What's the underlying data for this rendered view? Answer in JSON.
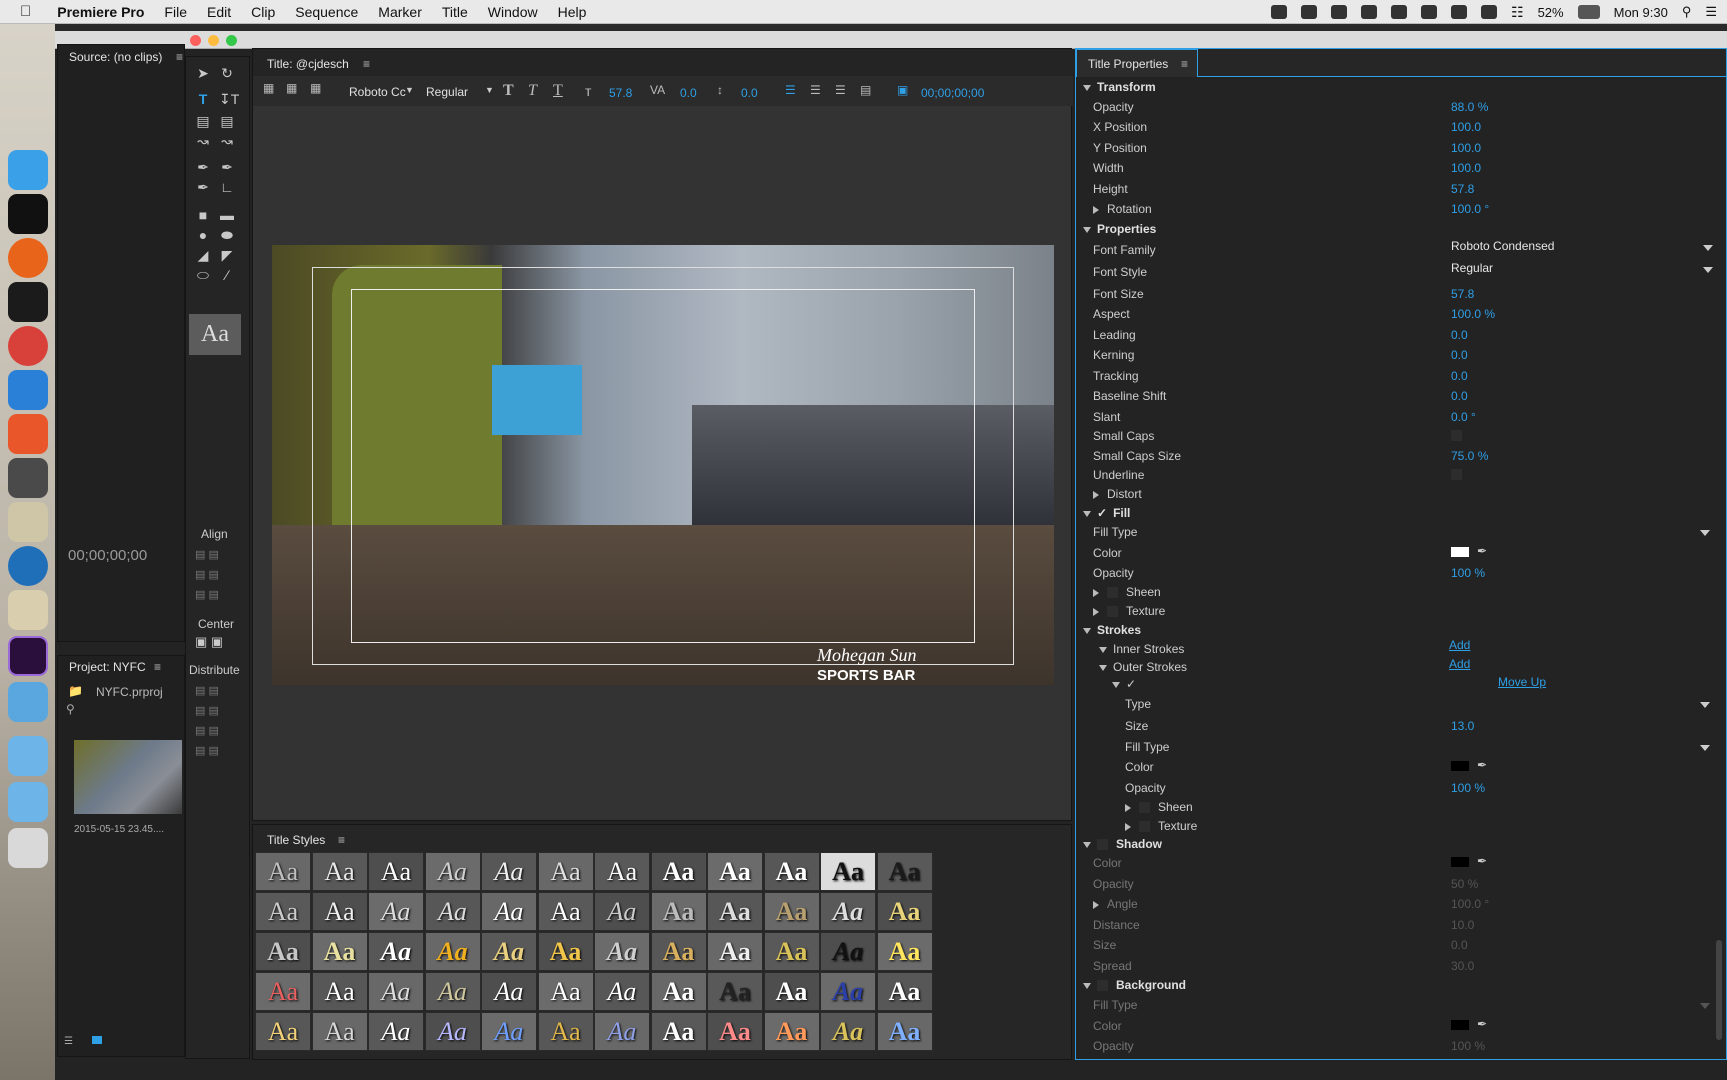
{
  "menubar": {
    "app": "Premiere Pro",
    "items": [
      "File",
      "Edit",
      "Clip",
      "Sequence",
      "Marker",
      "Title",
      "Window",
      "Help"
    ],
    "battery": "52%",
    "clock": "Mon 9:30"
  },
  "source_panel": {
    "title": "Source: (no clips)",
    "timecode": "00;00;00;00"
  },
  "project_panel": {
    "title": "Project: NYFC",
    "file": "NYFC.prproj",
    "clip_label": "2015-05-15 23.45...."
  },
  "title_panel": {
    "title": "Title: @cjdesch",
    "font": "Roboto Cc",
    "style": "Regular",
    "size": "57.8",
    "kerning": "0.0",
    "leading": "0.0",
    "timecode": "00;00;00;00"
  },
  "video": {
    "watermark": "Mohegan Sun",
    "sub": "SPORTS BAR"
  },
  "tools": {
    "sample": "Aa",
    "align": "Align",
    "center": "Center",
    "distribute": "Distribute"
  },
  "title_styles": {
    "title": "Title Styles",
    "sample": "Aa"
  },
  "props": {
    "title": "Title Properties",
    "transform": "Transform",
    "opacity_l": "Opacity",
    "opacity_v": "88.0 %",
    "xpos_l": "X Position",
    "xpos_v": "100.0",
    "ypos_l": "Y Position",
    "ypos_v": "100.0",
    "width_l": "Width",
    "width_v": "100.0",
    "height_l": "Height",
    "height_v": "57.8",
    "rot_l": "Rotation",
    "rot_v": "100.0 °",
    "properties": "Properties",
    "ff_l": "Font Family",
    "ff_v": "Roboto Condensed",
    "fs_l": "Font Style",
    "fs_v": "Regular",
    "fsize_l": "Font Size",
    "fsize_v": "57.8",
    "aspect_l": "Aspect",
    "aspect_v": "100.0 %",
    "leading_l": "Leading",
    "leading_v": "0.0",
    "kerning_l": "Kerning",
    "kerning_v": "0.0",
    "tracking_l": "Tracking",
    "tracking_v": "0.0",
    "baseline_l": "Baseline Shift",
    "baseline_v": "0.0",
    "slant_l": "Slant",
    "slant_v": "0.0 °",
    "smallcaps_l": "Small Caps",
    "smallcapssize_l": "Small Caps Size",
    "smallcapssize_v": "75.0 %",
    "underline_l": "Underline",
    "distort_l": "Distort",
    "fill": "Fill",
    "filltype_l": "Fill Type",
    "color_l": "Color",
    "fillopacity_l": "Opacity",
    "fillopacity_v": "100 %",
    "sheen_l": "Sheen",
    "texture_l": "Texture",
    "strokes": "Strokes",
    "inner_l": "Inner Strokes",
    "inner_add": "Add",
    "outer_l": "Outer Strokes",
    "outer_add": "Add",
    "moveup": "Move Up",
    "type_l": "Type",
    "size_l": "Size",
    "size_v": "13.0",
    "sfilltype_l": "Fill Type",
    "scolor_l": "Color",
    "sopacity_l": "Opacity",
    "sopacity_v": "100 %",
    "ssheen_l": "Sheen",
    "stexture_l": "Texture",
    "shadow": "Shadow",
    "shcolor_l": "Color",
    "shopacity_l": "Opacity",
    "shopacity_v": "50 %",
    "shangle_l": "Angle",
    "shangle_v": "100.0 °",
    "shdist_l": "Distance",
    "shdist_v": "10.0",
    "shsize_l": "Size",
    "shsize_v": "0.0",
    "shspread_l": "Spread",
    "shspread_v": "30.0",
    "background": "Background",
    "bgfill_l": "Fill Type",
    "bgcolor_l": "Color",
    "bgopacity_l": "Opacity",
    "bgopacity_v": "100 %"
  }
}
